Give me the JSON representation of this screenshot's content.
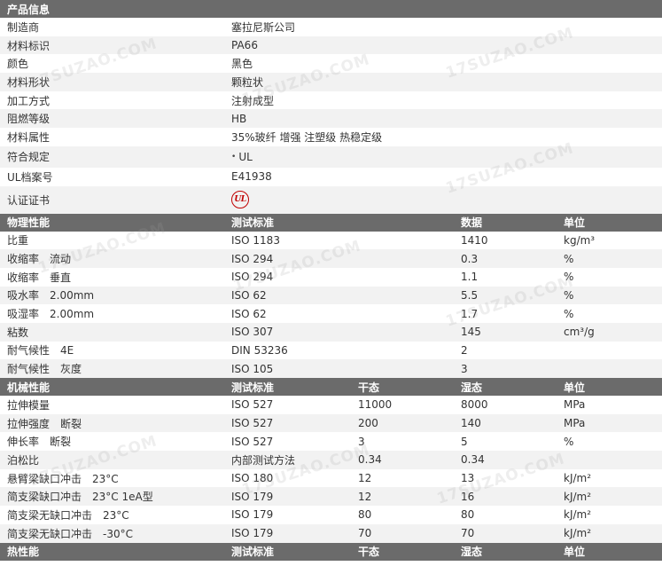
{
  "watermark": "17SUZAO.COM",
  "sections": [
    {
      "header": [
        "产品信息"
      ],
      "rows": [
        [
          "制造商",
          "塞拉尼斯公司"
        ],
        [
          "材料标识",
          "PA66"
        ],
        [
          "颜色",
          "黑色"
        ],
        [
          "材料形状",
          "颗粒状"
        ],
        [
          "加工方式",
          "注射成型"
        ],
        [
          "阻燃等级",
          "HB"
        ],
        [
          "材料属性",
          "35%玻纤 增强 注塑级 热稳定级"
        ],
        [
          "符合规定",
          "UL"
        ],
        [
          "UL档案号",
          "E41938"
        ],
        [
          "认证证书",
          ""
        ]
      ],
      "cert_logo": "UL"
    },
    {
      "header": [
        "物理性能",
        "测试标准",
        "",
        "数据",
        "单位"
      ],
      "rows": [
        [
          "比重",
          "ISO 1183",
          "",
          "1410",
          "kg/m³"
        ],
        [
          "收缩率　流动",
          "ISO 294",
          "",
          "0.3",
          "%"
        ],
        [
          "收缩率　垂直",
          "ISO 294",
          "",
          "1.1",
          "%"
        ],
        [
          "吸水率　2.00mm",
          "ISO 62",
          "",
          "5.5",
          "%"
        ],
        [
          "吸湿率　2.00mm",
          "ISO 62",
          "",
          "1.7",
          "%"
        ],
        [
          "粘数",
          "ISO 307",
          "",
          "145",
          "cm³/g"
        ],
        [
          "耐气候性　4E",
          "DIN 53236",
          "",
          "2",
          ""
        ],
        [
          "耐气候性　灰度",
          "ISO 105",
          "",
          "3",
          ""
        ]
      ]
    },
    {
      "header": [
        "机械性能",
        "测试标准",
        "干态",
        "湿态",
        "单位"
      ],
      "rows": [
        [
          "拉伸模量",
          "ISO 527",
          "11000",
          "8000",
          "MPa"
        ],
        [
          "拉伸强度　断裂",
          "ISO 527",
          "200",
          "140",
          "MPa"
        ],
        [
          "伸长率　断裂",
          "ISO 527",
          "3",
          "5",
          "%"
        ],
        [
          "泊松比",
          "内部测试方法",
          "0.34",
          "0.34",
          ""
        ],
        [
          "悬臂梁缺口冲击　23°C",
          "ISO 180",
          "12",
          "13",
          "kJ/m²"
        ],
        [
          "简支梁缺口冲击　23°C 1eA型",
          "ISO 179",
          "12",
          "16",
          "kJ/m²"
        ],
        [
          "简支梁无缺口冲击　23°C",
          "ISO 179",
          "80",
          "80",
          "kJ/m²"
        ],
        [
          "简支梁无缺口冲击　-30°C",
          "ISO 179",
          "70",
          "70",
          "kJ/m²"
        ]
      ]
    },
    {
      "header": [
        "热性能",
        "测试标准",
        "干态",
        "湿态",
        "单位"
      ],
      "rows": []
    }
  ]
}
